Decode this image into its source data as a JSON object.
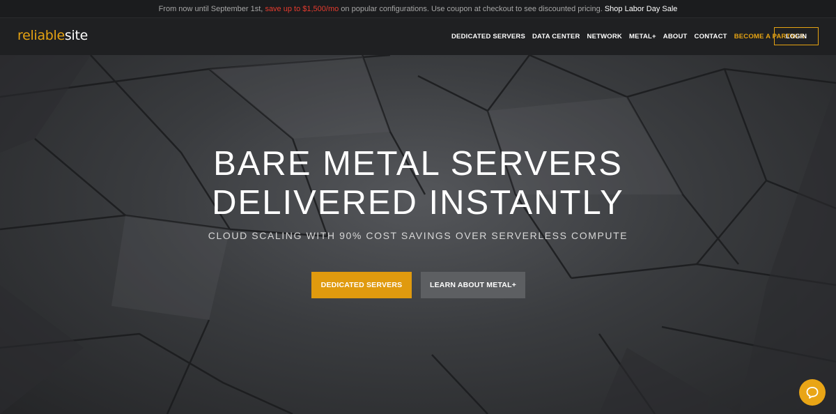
{
  "promo": {
    "prefix": "From now until September 1st,",
    "highlight": "save up to $1,500/mo",
    "suffix": "on popular configurations. Use coupon at checkout to see discounted pricing.",
    "link": "Shop Labor Day Sale"
  },
  "header": {
    "logo_part1": "reliable",
    "logo_part2": "site",
    "nav": [
      {
        "label": "DEDICATED SERVERS"
      },
      {
        "label": "DATA CENTER"
      },
      {
        "label": "NETWORK"
      },
      {
        "label": "METAL+"
      },
      {
        "label": "ABOUT"
      },
      {
        "label": "CONTACT"
      },
      {
        "label": "BECOME A PARTNER"
      }
    ],
    "login": "LOGIN"
  },
  "hero": {
    "title_line1": "BARE METAL SERVERS",
    "title_line2": "DELIVERED INSTANTLY",
    "subtitle": "CLOUD SCALING WITH 90% COST SAVINGS OVER SERVERLESS COMPUTE",
    "primary_button": "DEDICATED SERVERS",
    "secondary_button": "LEARN ABOUT METAL+"
  },
  "chat": {
    "icon": "chat-bubble-icon"
  },
  "colors": {
    "accent": "#e6a312",
    "promo_highlight": "#e63b2e",
    "header_bg": "#1f2022"
  }
}
